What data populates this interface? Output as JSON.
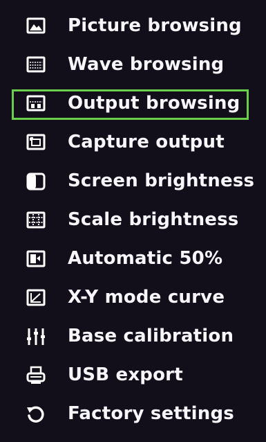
{
  "menu": {
    "selected_index": 2,
    "items": [
      {
        "label": "Picture browsing",
        "icon": "picture-icon"
      },
      {
        "label": "Wave browsing",
        "icon": "wave-icon"
      },
      {
        "label": "Output browsing",
        "icon": "output-icon"
      },
      {
        "label": "Capture output",
        "icon": "capture-icon"
      },
      {
        "label": "Screen brightness",
        "icon": "brightness-icon"
      },
      {
        "label": "Scale brightness",
        "icon": "scale-grid-icon"
      },
      {
        "label": "Automatic 50%",
        "icon": "automatic-icon"
      },
      {
        "label": "X-Y mode curve",
        "icon": "xy-curve-icon"
      },
      {
        "label": "Base calibration",
        "icon": "calibration-icon"
      },
      {
        "label": "USB export",
        "icon": "usb-export-icon"
      },
      {
        "label": "Factory settings",
        "icon": "factory-reset-icon"
      }
    ]
  },
  "colors": {
    "background": "#120f1b",
    "text": "#f6f6fb",
    "selection": "#6ad04b"
  }
}
